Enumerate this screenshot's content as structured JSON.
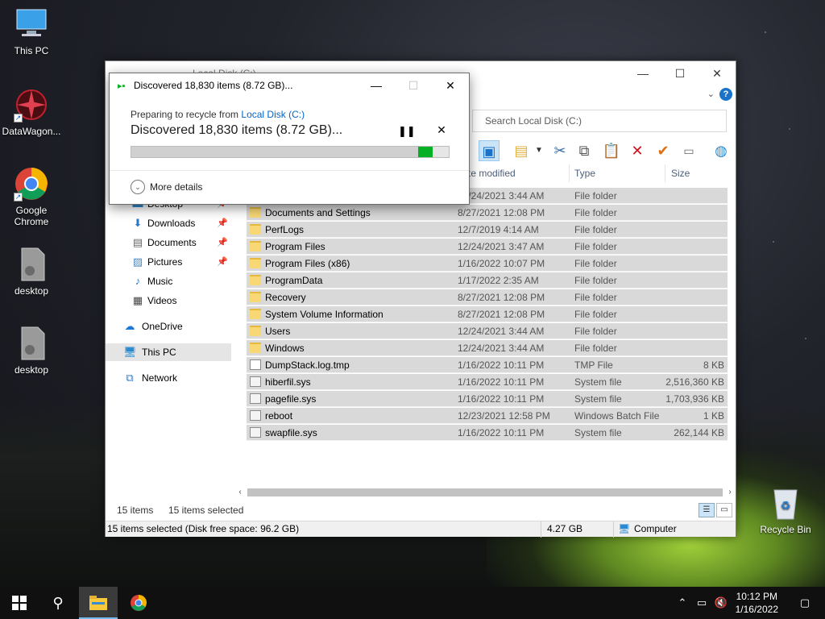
{
  "desktop": {
    "icons": [
      {
        "label": "This PC"
      },
      {
        "label": "DataWagon..."
      },
      {
        "label": "Google Chrome"
      },
      {
        "label": "desktop"
      },
      {
        "label": "desktop"
      },
      {
        "label": "Recycle Bin"
      }
    ]
  },
  "explorer": {
    "title": "Local Disk (C:)",
    "search_placeholder": "Search Local Disk (C:)",
    "columns": {
      "date": "te modified",
      "type": "Type",
      "size": "Size"
    },
    "nav": [
      {
        "label": "Desktop",
        "icon": "desktop-icon",
        "pinned": true
      },
      {
        "label": "Downloads",
        "icon": "download-icon",
        "pinned": true
      },
      {
        "label": "Documents",
        "icon": "documents-icon",
        "pinned": true
      },
      {
        "label": "Pictures",
        "icon": "pictures-icon",
        "pinned": true
      },
      {
        "label": "Music",
        "icon": "music-icon",
        "pinned": false
      },
      {
        "label": "Videos",
        "icon": "videos-icon",
        "pinned": false
      },
      {
        "label": "OneDrive",
        "icon": "onedrive-icon",
        "pinned": false
      },
      {
        "label": "This PC",
        "icon": "computer-icon",
        "pinned": false
      },
      {
        "label": "Network",
        "icon": "network-icon",
        "pinned": false
      }
    ],
    "files": [
      {
        "name": "",
        "date": "12/24/2021 3:44 AM",
        "type": "File folder",
        "size": "",
        "kind": "folder"
      },
      {
        "name": "Documents and Settings",
        "date": "8/27/2021 12:08 PM",
        "type": "File folder",
        "size": "",
        "kind": "folder"
      },
      {
        "name": "PerfLogs",
        "date": "12/7/2019 4:14 AM",
        "type": "File folder",
        "size": "",
        "kind": "folder"
      },
      {
        "name": "Program Files",
        "date": "12/24/2021 3:47 AM",
        "type": "File folder",
        "size": "",
        "kind": "folder"
      },
      {
        "name": "Program Files (x86)",
        "date": "1/16/2022 10:07 PM",
        "type": "File folder",
        "size": "",
        "kind": "folder"
      },
      {
        "name": "ProgramData",
        "date": "1/17/2022 2:35 AM",
        "type": "File folder",
        "size": "",
        "kind": "folder"
      },
      {
        "name": "Recovery",
        "date": "8/27/2021 12:08 PM",
        "type": "File folder",
        "size": "",
        "kind": "folder"
      },
      {
        "name": "System Volume Information",
        "date": "8/27/2021 12:08 PM",
        "type": "File folder",
        "size": "",
        "kind": "folder"
      },
      {
        "name": "Users",
        "date": "12/24/2021 3:44 AM",
        "type": "File folder",
        "size": "",
        "kind": "folder"
      },
      {
        "name": "Windows",
        "date": "12/24/2021 3:44 AM",
        "type": "File folder",
        "size": "",
        "kind": "folder"
      },
      {
        "name": "DumpStack.log.tmp",
        "date": "1/16/2022 10:11 PM",
        "type": "TMP File",
        "size": "8 KB",
        "kind": "file"
      },
      {
        "name": "hiberfil.sys",
        "date": "1/16/2022 10:11 PM",
        "type": "System file",
        "size": "2,516,360 KB",
        "kind": "sys"
      },
      {
        "name": "pagefile.sys",
        "date": "1/16/2022 10:11 PM",
        "type": "System file",
        "size": "1,703,936 KB",
        "kind": "sys"
      },
      {
        "name": "reboot",
        "date": "12/23/2021 12:58 PM",
        "type": "Windows Batch File",
        "size": "1 KB",
        "kind": "sys"
      },
      {
        "name": "swapfile.sys",
        "date": "1/16/2022 10:11 PM",
        "type": "System file",
        "size": "262,144 KB",
        "kind": "sys"
      }
    ],
    "status": {
      "items": "15 items",
      "selected": "15 items selected"
    },
    "bottom": {
      "selection": "15 items selected (Disk free space: 96.2 GB)",
      "size": "4.27 GB",
      "location": "Computer"
    }
  },
  "dialog": {
    "title": "Discovered 18,830 items (8.72 GB)...",
    "subtitle_prefix": "Preparing to recycle from ",
    "subtitle_link": "Local Disk (C:)",
    "main": "Discovered 18,830 items (8.72 GB)...",
    "progress": 0.95,
    "more_details": "More details"
  },
  "taskbar": {
    "time": "10:12 PM",
    "date": "1/16/2022"
  },
  "colors": {
    "accent": "#0066cc",
    "progress_green": "#06b025",
    "selection": "#d9d9d9"
  }
}
